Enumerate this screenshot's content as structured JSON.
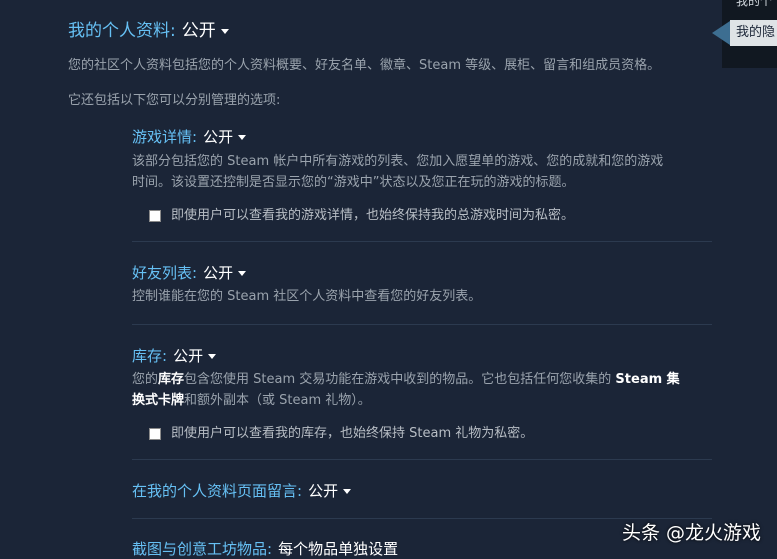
{
  "profile": {
    "title": "我的个人资料:",
    "value": "公开",
    "desc": "您的社区个人资料包括您的个人资料概要、好友名单、徽章、Steam 等级、展柜、留言和组成员资格。",
    "sub": "它还包括以下您可以分别管理的选项:"
  },
  "game_details": {
    "title": "游戏详情:",
    "value": "公开",
    "desc_line1": "该部分包括您的 Steam 帐户中所有游戏的列表、您加入愿望单的游戏、您的成就和您的游戏",
    "desc_line2": "时间。该设置还控制是否显示您的“游戏中”状态以及您正在玩的游戏的标题。",
    "checkbox_label": "即使用户可以查看我的游戏详情，也始终保持我的总游戏时间为私密。"
  },
  "friends_list": {
    "title": "好友列表:",
    "value": "公开",
    "desc": "控制谁能在您的 Steam 社区个人资料中查看您的好友列表。"
  },
  "inventory": {
    "title": "库存:",
    "value": "公开",
    "desc_a": "您的",
    "desc_b": "库存",
    "desc_c": "包含您使用 Steam 交易功能在游戏中收到的物品。它也包括任何您收集的",
    "desc_d": "Steam 集",
    "desc_e": "换式卡牌",
    "desc_f": "和额外副本（或 Steam 礼物）。",
    "checkbox_label": "即使用户可以查看我的库存，也始终保持 Steam 礼物为私密。"
  },
  "comments": {
    "title": "在我的个人资料页面留言:",
    "value": "公开"
  },
  "screenshots": {
    "title": "截图与创意工坊物品:",
    "value": "每个物品单独设置"
  },
  "tooltip": {
    "text": "我的隐",
    "top_text": "我的个"
  },
  "watermark": "头条 @龙火游戏",
  "colors": {
    "background": "#1b2537",
    "accent": "#66c0f4",
    "value": "#ffffff"
  }
}
